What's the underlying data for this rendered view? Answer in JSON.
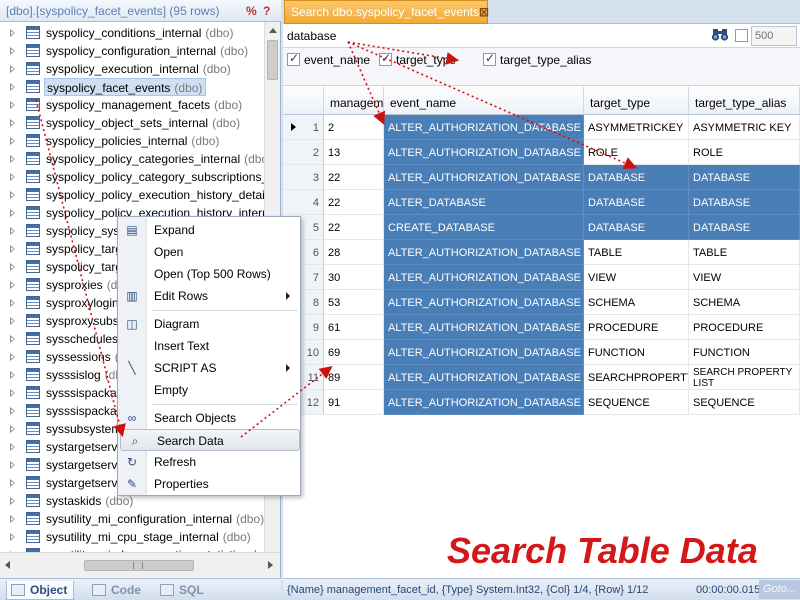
{
  "left_panel": {
    "title": "[dbo].[syspolicy_facet_events] (95 rows)",
    "pct_label": "%",
    "help_label": "?",
    "tree_items": [
      {
        "name": "syspolicy_conditions_internal",
        "schema": "(dbo)"
      },
      {
        "name": "syspolicy_configuration_internal",
        "schema": "(dbo)"
      },
      {
        "name": "syspolicy_execution_internal",
        "schema": "(dbo)"
      },
      {
        "name": "syspolicy_facet_events",
        "schema": "(dbo)",
        "selected": true
      },
      {
        "name": "syspolicy_management_facets",
        "schema": "(dbo)"
      },
      {
        "name": "syspolicy_object_sets_internal",
        "schema": "(dbo)"
      },
      {
        "name": "syspolicy_policies_internal",
        "schema": "(dbo)"
      },
      {
        "name": "syspolicy_policy_categories_internal",
        "schema": "(dbo)"
      },
      {
        "name": "syspolicy_policy_category_subscriptions_in",
        "schema": ""
      },
      {
        "name": "syspolicy_policy_execution_history_details",
        "schema": ""
      },
      {
        "name": "syspolicy_policy_execution_history_interna",
        "schema": ""
      },
      {
        "name": "syspolicy_syste",
        "schema": ""
      },
      {
        "name": "syspolicy_targ",
        "schema": ""
      },
      {
        "name": "syspolicy_targ",
        "schema": ""
      },
      {
        "name": "sysproxies",
        "schema": "(dbo)"
      },
      {
        "name": "sysproxylogin",
        "schema": ""
      },
      {
        "name": "sysproxysubsy",
        "schema": ""
      },
      {
        "name": "sysschedules",
        "schema": ""
      },
      {
        "name": "syssessions",
        "schema": "(d"
      },
      {
        "name": "sysssislog",
        "schema": "(db"
      },
      {
        "name": "sysssispackage",
        "schema": ""
      },
      {
        "name": "sysssispackag",
        "schema": ""
      },
      {
        "name": "syssubsystems",
        "schema": ""
      },
      {
        "name": "systargetserve",
        "schema": ""
      },
      {
        "name": "systargetserve",
        "schema": ""
      },
      {
        "name": "systargetserve",
        "schema": ""
      },
      {
        "name": "systaskids",
        "schema": "(dbo)"
      },
      {
        "name": "sysutility_mi_configuration_internal",
        "schema": "(dbo)"
      },
      {
        "name": "sysutility_mi_cpu_stage_internal",
        "schema": "(dbo)"
      },
      {
        "name": "sysutility_mi_dac_execution_statistics_inte",
        "schema": ""
      }
    ],
    "bottom_tabs": [
      {
        "label": "Object",
        "icon": "object-icon",
        "active": true
      },
      {
        "label": "Code",
        "icon": "code-icon",
        "active": false
      },
      {
        "label": "SQL",
        "icon": "sql-icon",
        "active": false
      }
    ]
  },
  "document_tab": {
    "label": "Search dbo.syspolicy_facet_events",
    "close": "⊠"
  },
  "search": {
    "value": "database",
    "limit_placeholder": "500"
  },
  "column_filters": [
    {
      "label": "event_name",
      "checked": true
    },
    {
      "label": "target_type",
      "checked": true
    },
    {
      "label": "target_type_alias",
      "checked": true
    }
  ],
  "grid": {
    "columns": [
      "managem",
      "event_name",
      "target_type",
      "target_type_alias"
    ],
    "rows": [
      {
        "n": "1",
        "id": "2",
        "event": "ALTER_AUTHORIZATION_DATABASE",
        "type": "ASYMMETRICKEY",
        "alias": "ASYMMETRIC KEY",
        "sel": [
          false,
          true,
          false,
          false
        ],
        "current": true
      },
      {
        "n": "2",
        "id": "13",
        "event": "ALTER_AUTHORIZATION_DATABASE",
        "type": "ROLE",
        "alias": "ROLE",
        "sel": [
          false,
          true,
          false,
          false
        ]
      },
      {
        "n": "3",
        "id": "22",
        "event": "ALTER_AUTHORIZATION_DATABASE",
        "type": "DATABASE",
        "alias": "DATABASE",
        "sel": [
          false,
          true,
          true,
          true
        ]
      },
      {
        "n": "4",
        "id": "22",
        "event": "ALTER_DATABASE",
        "type": "DATABASE",
        "alias": "DATABASE",
        "sel": [
          false,
          true,
          true,
          true
        ]
      },
      {
        "n": "5",
        "id": "22",
        "event": "CREATE_DATABASE",
        "type": "DATABASE",
        "alias": "DATABASE",
        "sel": [
          false,
          true,
          true,
          true
        ]
      },
      {
        "n": "6",
        "id": "28",
        "event": "ALTER_AUTHORIZATION_DATABASE",
        "type": "TABLE",
        "alias": "TABLE",
        "sel": [
          false,
          true,
          false,
          false
        ]
      },
      {
        "n": "7",
        "id": "30",
        "event": "ALTER_AUTHORIZATION_DATABASE",
        "type": "VIEW",
        "alias": "VIEW",
        "sel": [
          false,
          true,
          false,
          false
        ]
      },
      {
        "n": "8",
        "id": "53",
        "event": "ALTER_AUTHORIZATION_DATABASE",
        "type": "SCHEMA",
        "alias": "SCHEMA",
        "sel": [
          false,
          true,
          false,
          false
        ]
      },
      {
        "n": "9",
        "id": "61",
        "event": "ALTER_AUTHORIZATION_DATABASE",
        "type": "PROCEDURE",
        "alias": "PROCEDURE",
        "sel": [
          false,
          true,
          false,
          false
        ]
      },
      {
        "n": "10",
        "id": "69",
        "event": "ALTER_AUTHORIZATION_DATABASE",
        "type": "FUNCTION",
        "alias": "FUNCTION",
        "sel": [
          false,
          true,
          false,
          false
        ]
      },
      {
        "n": "11",
        "id": "89",
        "event": "ALTER_AUTHORIZATION_DATABASE",
        "type": "SEARCHPROPERTYLIS",
        "alias": "SEARCH PROPERTY LIST",
        "sel": [
          false,
          true,
          false,
          false
        ]
      },
      {
        "n": "12",
        "id": "91",
        "event": "ALTER_AUTHORIZATION_DATABASE",
        "type": "SEQUENCE",
        "alias": "SEQUENCE",
        "sel": [
          false,
          true,
          false,
          false
        ]
      }
    ]
  },
  "context_menu": {
    "items": [
      {
        "label": "Expand",
        "icon": "expand-icon",
        "glyph": "▤"
      },
      {
        "label": "Open",
        "icon": "",
        "glyph": ""
      },
      {
        "label": "Open (Top 500 Rows)",
        "icon": "",
        "glyph": ""
      },
      {
        "label": "Edit Rows",
        "icon": "edit-rows-icon",
        "glyph": "▥",
        "submenu": true
      },
      {
        "sep": true
      },
      {
        "label": "Diagram",
        "icon": "diagram-icon",
        "glyph": "◫"
      },
      {
        "label": "Insert Text",
        "icon": "",
        "glyph": ""
      },
      {
        "label": "SCRIPT AS",
        "icon": "script-icon",
        "glyph": "╲",
        "submenu": true
      },
      {
        "label": "Empty",
        "icon": "",
        "glyph": ""
      },
      {
        "sep": true
      },
      {
        "label": "Search Objects",
        "icon": "binoculars-icon",
        "glyph": "∞"
      },
      {
        "label": "Search Data",
        "icon": "search-data-icon",
        "glyph": "⌕",
        "highlight": true
      },
      {
        "label": "Refresh",
        "icon": "refresh-icon",
        "glyph": "↻"
      },
      {
        "label": "Properties",
        "icon": "properties-icon",
        "glyph": "✎"
      }
    ]
  },
  "status": {
    "info": "{Name} management_facet_id, {Type} System.Int32, {Col} 1/4, {Row} 1/12",
    "time": "00:00:00.015",
    "goto": "Goto..."
  },
  "caption": "Search Table Data",
  "colors": {
    "accent": "#f3a937",
    "selection": "#4a7eb7",
    "arrow": "#cc1111",
    "caption": "#d21818"
  }
}
